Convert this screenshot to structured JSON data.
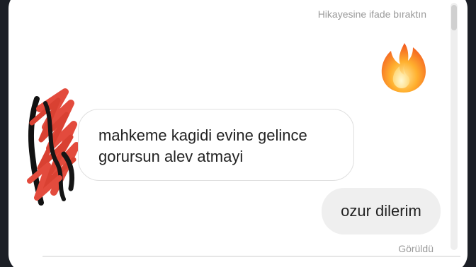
{
  "chat": {
    "reaction_note": "Hikayesine ifade bıraktın",
    "reaction_emoji": "fire-emoji",
    "messages": [
      {
        "direction": "incoming",
        "text": "mahkeme kagidi evine gelince gorursun alev atmayi"
      },
      {
        "direction": "outgoing",
        "text": "ozur dilerim"
      }
    ],
    "seen_label": "Görüldü"
  },
  "colors": {
    "background": "#1c1f26",
    "panel": "#ffffff",
    "system_text": "#9a9a9a",
    "incoming_border": "#dfdfdf",
    "outgoing_bubble": "#efefef",
    "message_text": "#222222",
    "fire_outer": "#ff6d12",
    "fire_inner": "#ffd36a",
    "scribble_red": "#e34b3d"
  },
  "icons": {
    "avatar": "redacted-avatar-scribble",
    "reaction": "fire-emoji"
  }
}
